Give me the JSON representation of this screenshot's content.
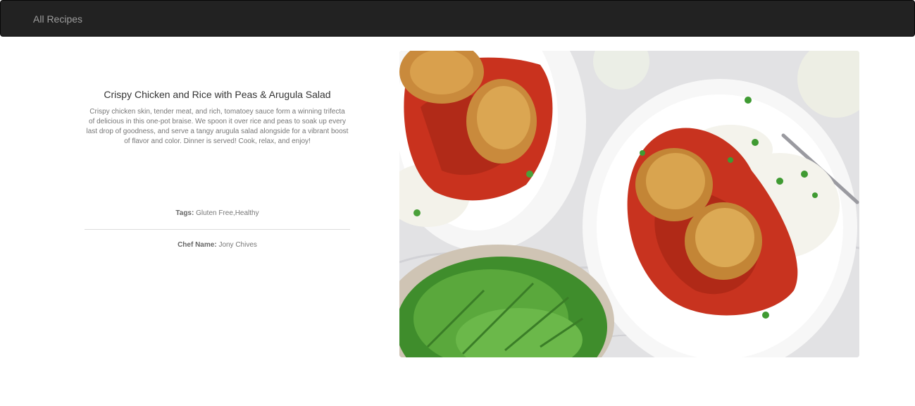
{
  "nav": {
    "link_label": "All Recipes"
  },
  "recipe": {
    "title": "Crispy Chicken and Rice with Peas & Arugula Salad",
    "description": "Crispy chicken skin, tender meat, and rich, tomatoey sauce form a winning trifecta of delicious in this one-pot braise. We spoon it over rice and peas to soak up every last drop of goodness, and serve a tangy arugula salad alongside for a vibrant boost of flavor and color. Dinner is served! Cook, relax, and enjoy!",
    "tags_label": "Tags:",
    "tags_value": "Gluten Free,Healthy",
    "chef_label": "Chef Name:",
    "chef_value": "Jony Chives"
  },
  "colors": {
    "navbar_bg": "#222222",
    "nav_link": "#9d9d9d",
    "text_muted": "#777777"
  }
}
